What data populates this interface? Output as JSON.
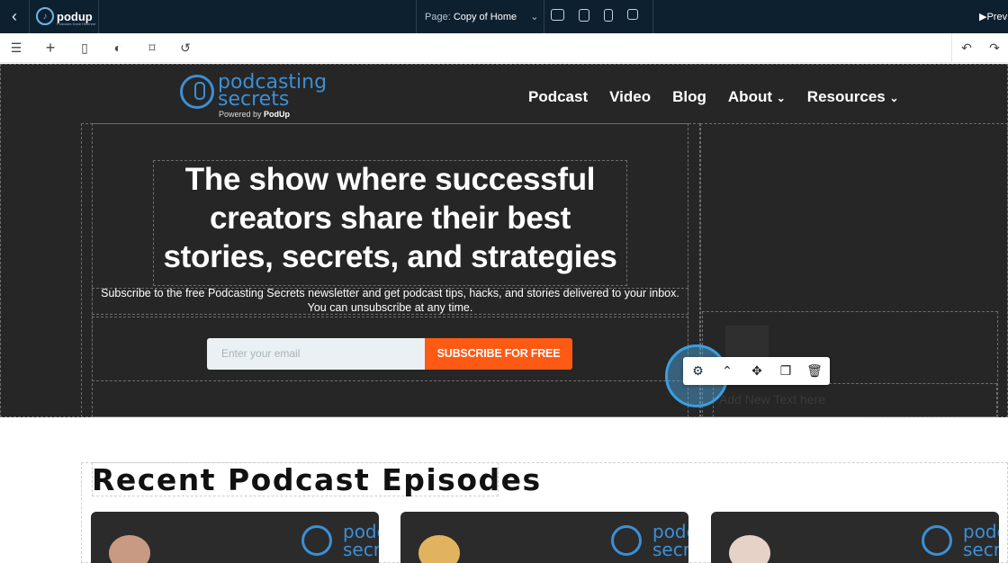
{
  "topbar": {
    "logo_text": "podup",
    "logo_tagline": "Podcasts Done Different",
    "page_label": "Page:",
    "page_name": "Copy of Home",
    "preview_label": "Prev"
  },
  "toolbar_icons": [
    "layers-icon",
    "add-icon",
    "pages-icon",
    "theme-icon",
    "bookmark-icon",
    "history-icon",
    "undo-icon",
    "redo-icon"
  ],
  "site": {
    "logo_word1": "podcasting",
    "logo_word2": "secrets",
    "powered_prefix": "Powered by",
    "powered_brand": "PodUp",
    "nav": [
      "Podcast",
      "Video",
      "Blog",
      "About",
      "Resources"
    ],
    "headline": "The show where successful creators share their best stories, secrets, and strategies",
    "subline": "Subscribe to the free Podcasting Secrets newsletter and get podcast tips, hacks, and stories delivered to your inbox. You can unsubscribe at any time.",
    "email_placeholder": "Enter your email",
    "subscribe_label": "SUBSCRIBE FOR FREE",
    "add_text": "Add New Text here",
    "recent_title": "Recent Podcast Episodes",
    "card_logo_text": "podc secr"
  },
  "colors": {
    "topbar": "#0d2030",
    "hero_bg": "#262626",
    "brand_blue": "#3c8fd6",
    "subscribe_orange": "#ff5a14"
  }
}
